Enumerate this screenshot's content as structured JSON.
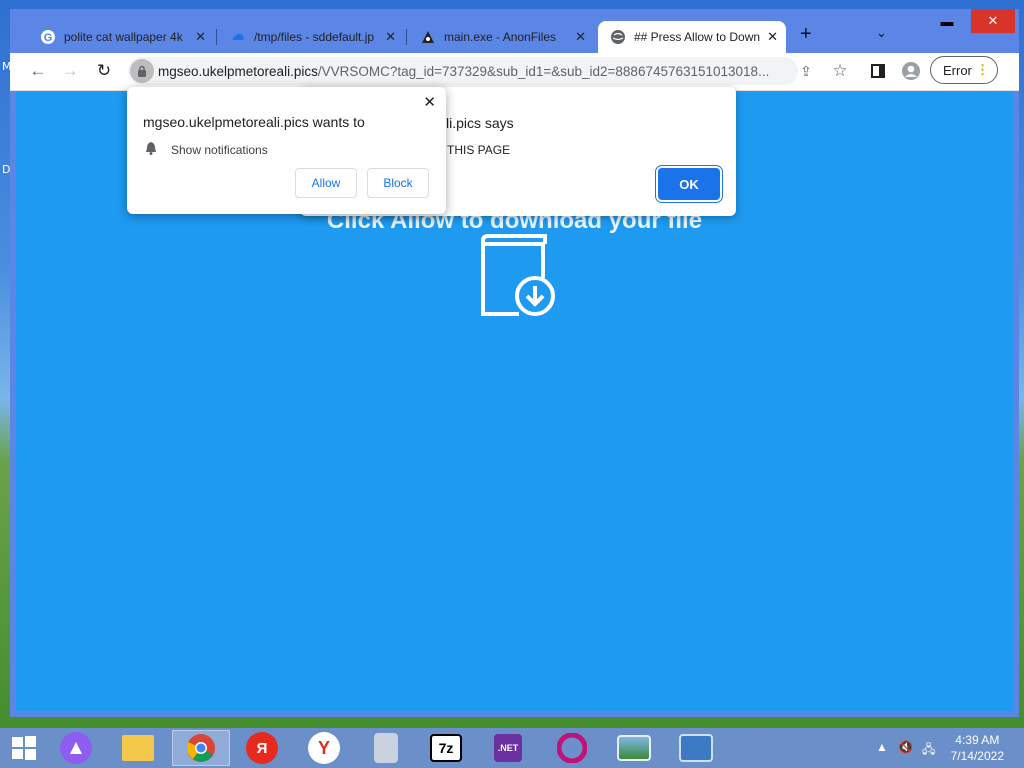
{
  "desktop": {
    "edge_letters": [
      "M",
      "D"
    ]
  },
  "browser": {
    "tabs": [
      {
        "label": "polite cat wallpaper 4k",
        "icon": "google-icon"
      },
      {
        "label": "/tmp/files - sddefault.jpg",
        "icon": "cloud-icon"
      },
      {
        "label": "main.exe - AnonFiles",
        "icon": "anonfiles-icon"
      },
      {
        "label": "## Press Allow to Down",
        "icon": "globe-icon",
        "active": true
      }
    ],
    "window_controls": {
      "minimize": "▬",
      "maximize": "❐",
      "close": "✕"
    },
    "url_host": "mgseo.ukelpmetoreali.pics",
    "url_path": "/VVRSOMC?tag_id=737329&sub_id1=&sub_id2=8886745763151013018...",
    "error_chip": "Error"
  },
  "page": {
    "headline": "Click Allow to download your file",
    "accent": "#1e9af0"
  },
  "alert_dialog": {
    "title": "mgseo.ukelpmetoreali.pics says",
    "visible_title": "li.pics says",
    "message": "THIS PAGE",
    "ok_label": "OK"
  },
  "permission_prompt": {
    "title": "mgseo.ukelpmetoreali.pics wants to",
    "permission": "Show notifications",
    "allow_label": "Allow",
    "block_label": "Block"
  },
  "taskbar": {
    "apps": [
      "start",
      "alice",
      "explorer",
      "chrome",
      "yandex-ya",
      "yandex-browser",
      "installer",
      "7zip",
      "dotnet",
      "opera",
      "picture-viewer",
      "control-panel"
    ],
    "clock_time": "4:39 AM",
    "clock_date": "7/14/2022"
  }
}
